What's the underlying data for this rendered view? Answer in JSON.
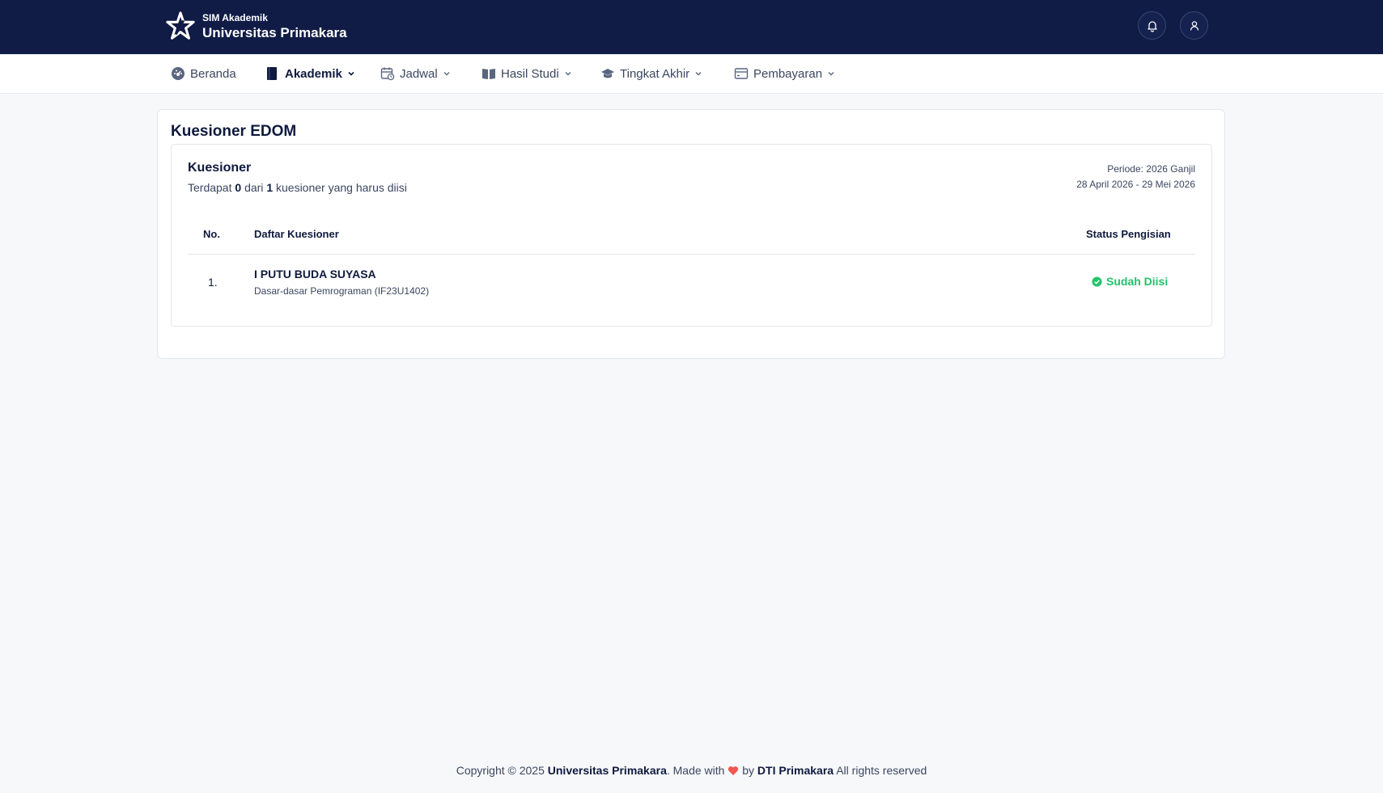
{
  "header": {
    "app_sub": "SIM Akademik",
    "app_title": "Universitas Primakara",
    "icons": [
      "bell-icon",
      "user-icon"
    ]
  },
  "nav": {
    "items": [
      {
        "label": "Beranda",
        "icon": "dashboard-icon"
      },
      {
        "label": "Akademik",
        "icon": "book-icon",
        "active": true
      },
      {
        "label": "Jadwal",
        "icon": "calendar-icon"
      },
      {
        "label": "Hasil Studi",
        "icon": "open-book-icon"
      },
      {
        "label": "Tingkat Akhir",
        "icon": "graduation-cap-icon"
      },
      {
        "label": "Pembayaran",
        "icon": "wallet-icon"
      }
    ]
  },
  "main": {
    "page_title": "Kuesioner EDOM",
    "section_title": "Kuesioner",
    "desc_prefix": "Terdapat",
    "filled_count": "0",
    "desc_mid": "dari",
    "total_count": "1",
    "desc_suffix": "kuesioner yang harus diisi",
    "periode_label": "Periode: 2026 Ganjil",
    "periode_range": "28 April 2026 - 29 Mei 2026",
    "table": {
      "columns": [
        "No.",
        "Daftar Kuesioner",
        "Status Pengisian"
      ],
      "rows": [
        {
          "no": "1.",
          "name": "I PUTU BUDA SUYASA",
          "course": "Dasar-dasar Pemrograman (IF23U1402)",
          "status": "Sudah Diisi"
        }
      ]
    }
  },
  "footer": {
    "copyright": "Copyright © 2025",
    "org": "Universitas Primakara",
    "made_with": ". Made with",
    "by": "by",
    "team": "DTI Primakara",
    "rights": "All rights reserved"
  },
  "colors": {
    "header_bg": "#101b46",
    "status_green": "#22c36a",
    "heart": "#f0574f"
  }
}
